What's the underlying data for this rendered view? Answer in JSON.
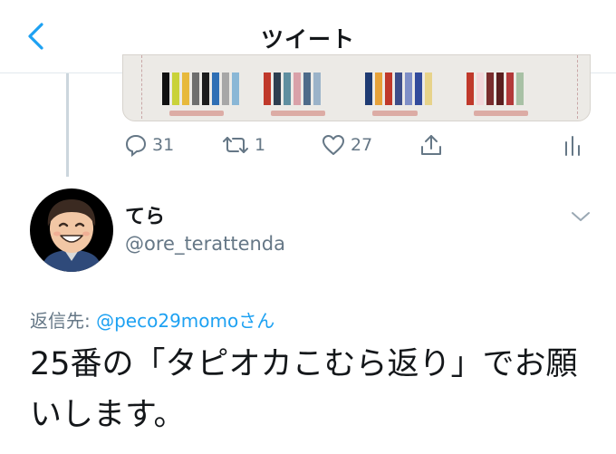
{
  "header": {
    "title": "ツイート",
    "back_icon": "chevron-left-icon",
    "accent_color": "#1da1f2"
  },
  "media": {
    "palettes": [
      [
        "#111111",
        "#c9d23a",
        "#e7b93c",
        "#6e6e6e",
        "#1c1c1c",
        "#2f6fb5",
        "#a7a7a7",
        "#8ab7d6"
      ],
      [
        "#c0392b",
        "#2c3e50",
        "#5f8fa0",
        "#d9a1a9",
        "#4d6b8a",
        "#9bb3c9"
      ],
      [
        "#1f3b73",
        "#e7a23a",
        "#c0392b",
        "#3d4e8a",
        "#7f8fc7",
        "#324b9c",
        "#e7d38a"
      ],
      [
        "#c0392b",
        "#f3d7da",
        "#7a2d2d",
        "#5b1f1f",
        "#b33a3a",
        "#a8c1a5"
      ]
    ]
  },
  "actions": {
    "reply": {
      "icon": "reply-icon",
      "count": "31"
    },
    "retweet": {
      "icon": "retweet-icon",
      "count": "1"
    },
    "like": {
      "icon": "heart-icon",
      "count": "27"
    },
    "share": {
      "icon": "share-icon"
    },
    "analytics": {
      "icon": "analytics-icon"
    }
  },
  "tweet": {
    "display_name": "てら",
    "handle": "@ore_terattenda",
    "reply_prefix": "返信先: ",
    "reply_handle": "@peco29momoさん",
    "text": "25番の「タピオカこむら返り」でお願いします。"
  }
}
